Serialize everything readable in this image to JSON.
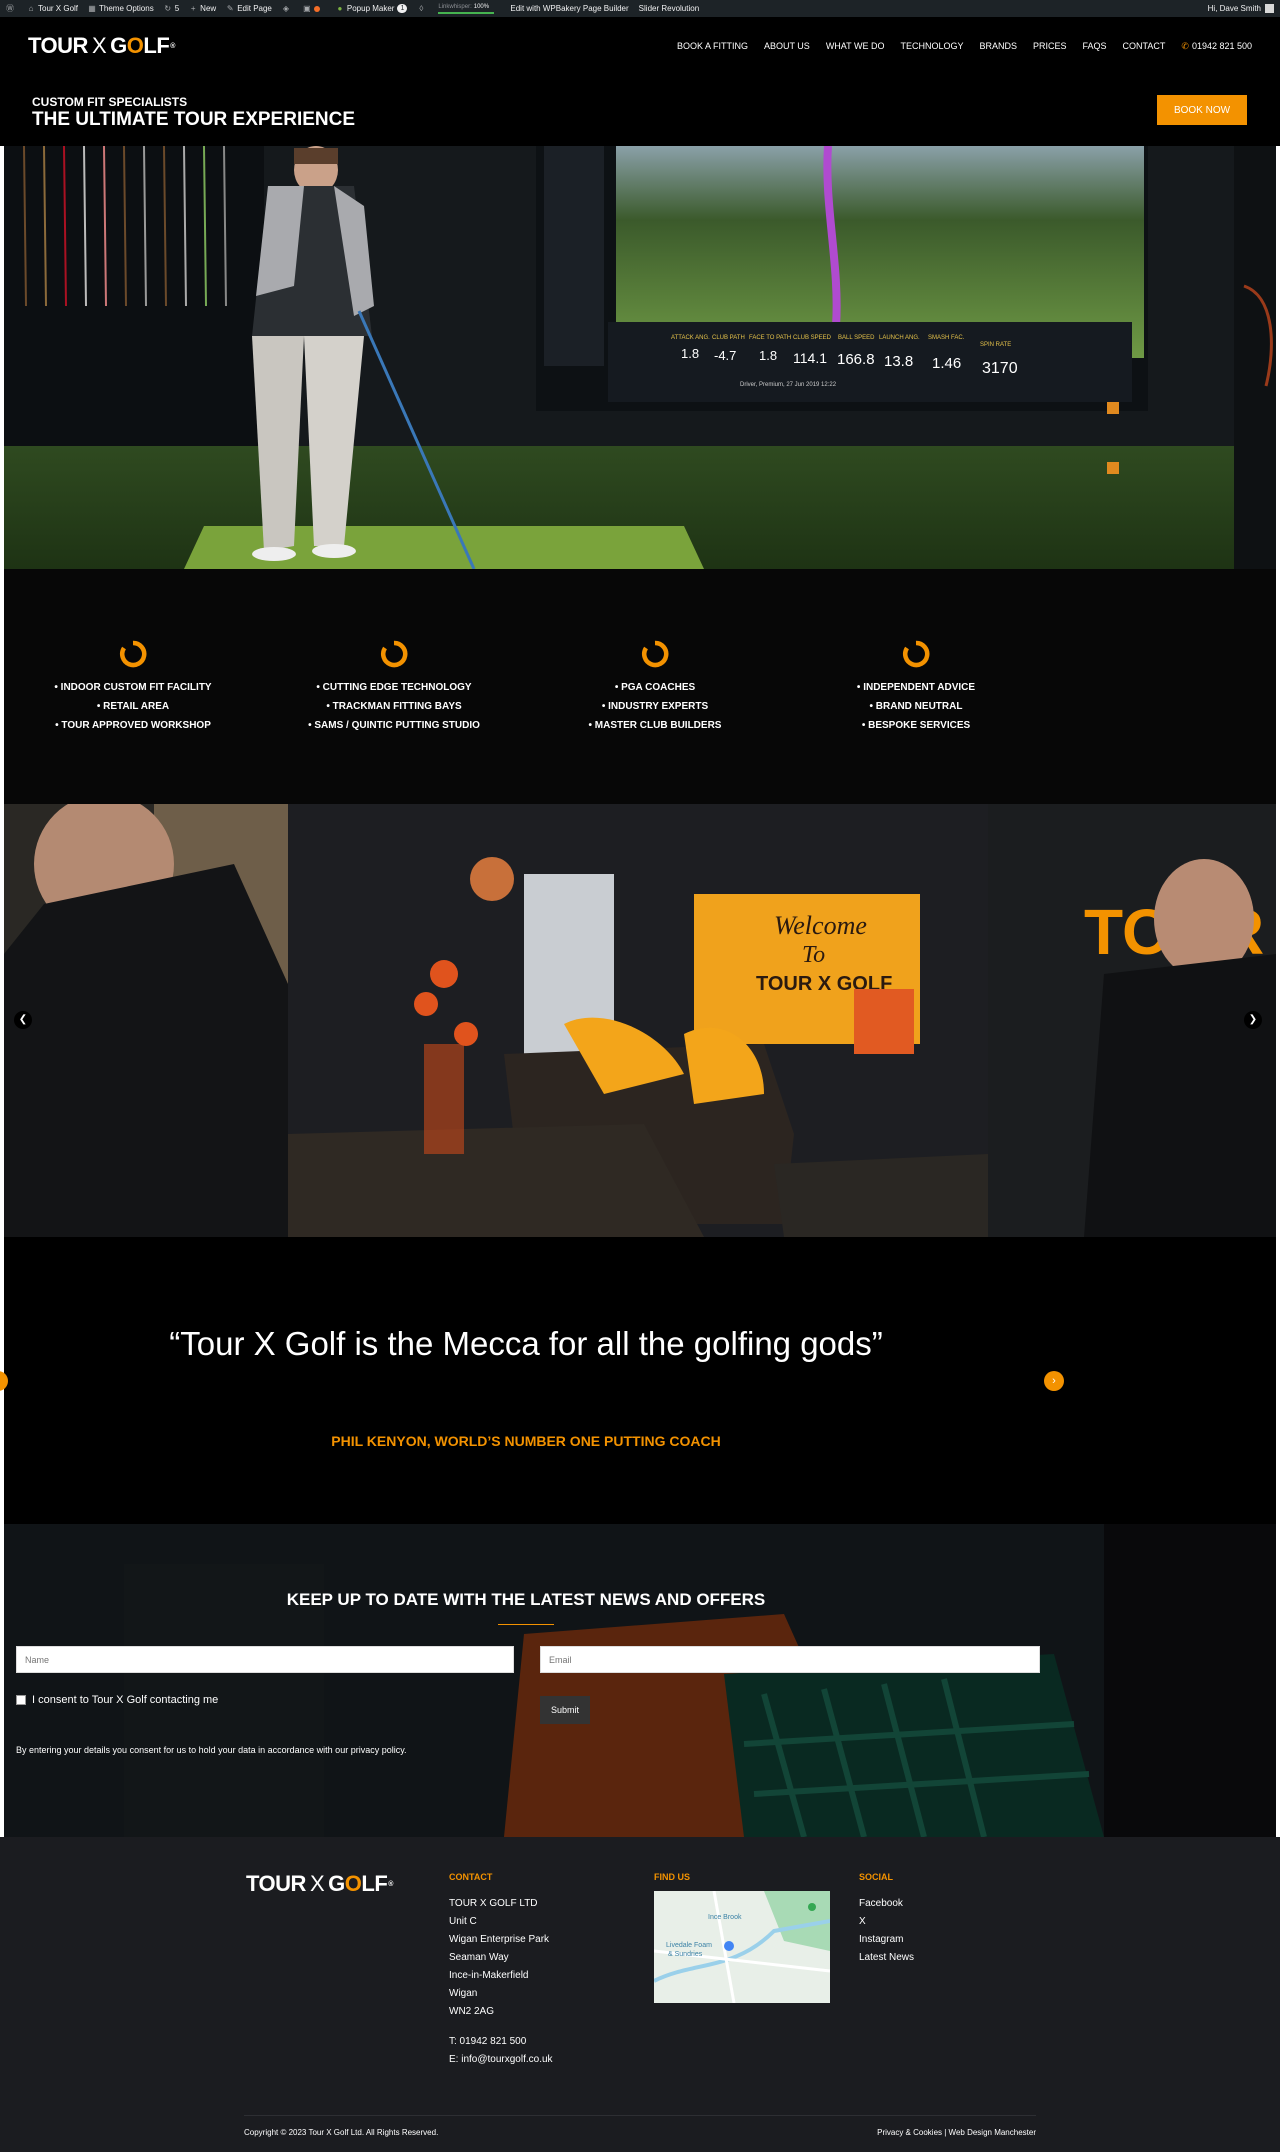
{
  "admin_bar": {
    "site_name": "Tour X Golf",
    "theme_options": "Theme Options",
    "updates_count": "5",
    "new_label": "New",
    "edit_page": "Edit Page",
    "popup_maker": "Popup Maker",
    "popup_count": "1",
    "linkwhisper_label": "Linkwhisper:",
    "linkwhisper_value": "100%",
    "wpbakery": "Edit with WPBakery Page Builder",
    "slider": "Slider Revolution",
    "greeting": "Hi, Dave Smith"
  },
  "nav": {
    "logo_left": "TOUR",
    "logo_x": "X",
    "logo_right_g": "G",
    "logo_right_o": "O",
    "logo_right_lf": "LF",
    "logo_tm": "®",
    "items": [
      "BOOK A FITTING",
      "ABOUT US",
      "WHAT WE DO",
      "TECHNOLOGY",
      "BRANDS",
      "PRICES",
      "FAQS",
      "CONTACT"
    ],
    "phone": "01942 821 500"
  },
  "hero": {
    "subtitle": "CUSTOM FIT SPECIALISTS",
    "title": "THE ULTIMATE TOUR EXPERIENCE",
    "book_button": "BOOK NOW"
  },
  "banner": {
    "stats_headers": [
      "ATTACK ANG.",
      "CLUB PATH",
      "FACE TO PATH",
      "CLUB SPEED",
      "BALL SPEED",
      "LAUNCH ANG.",
      "SMASH FAC.",
      "SPIN RATE"
    ],
    "stats_values": [
      "1.8",
      "-4.7",
      "1.8",
      "114.1",
      "166.8",
      "13.8",
      "1.46",
      "3170"
    ],
    "screen_footer": "Driver, Premium, 27 Jun 2019 12:22"
  },
  "features": [
    {
      "lines": [
        "• INDOOR CUSTOM FIT FACILITY",
        "• RETAIL AREA",
        "• TOUR APPROVED WORKSHOP"
      ]
    },
    {
      "lines": [
        "• CUTTING EDGE TECHNOLOGY",
        "• TRACKMAN FITTING BAYS",
        "• SAMS / QUINTIC PUTTING STUDIO"
      ]
    },
    {
      "lines": [
        "• PGA COACHES",
        "• INDUSTRY EXPERTS",
        "• MASTER CLUB BUILDERS"
      ]
    },
    {
      "lines": [
        "• INDEPENDENT ADVICE",
        "• BRAND NEUTRAL",
        "• BESPOKE SERVICES"
      ]
    }
  ],
  "gallery": {
    "prev_icon": "chevron-left-icon",
    "next_icon": "chevron-right-icon",
    "welcome_line1": "Welcome",
    "welcome_line2": "To",
    "welcome_brand": "TOUR X GOLF",
    "wall_text": "TOUR G"
  },
  "testimonial": {
    "quote": "“Tour X Golf is the Mecca for all the golfing gods”",
    "author": "PHIL KENYON, WORLD’S NUMBER ONE PUTTING COACH"
  },
  "newsletter": {
    "title": "KEEP UP TO DATE WITH THE LATEST NEWS AND OFFERS",
    "name_placeholder": "Name",
    "email_placeholder": "Email",
    "consent": "I consent to Tour X Golf contacting me",
    "submit": "Submit",
    "privacy": "By entering your details you consent for us to hold your data in accordance with our privacy policy."
  },
  "footer": {
    "contact_heading": "CONTACT",
    "address": [
      "TOUR X GOLF LTD",
      "Unit C",
      "Wigan Enterprise Park",
      "Seaman Way",
      "Ince-in-Makerfield",
      "Wigan",
      "WN2 2AG"
    ],
    "phone": "T: 01942 821 500",
    "email": "E: info@tourxgolf.co.uk",
    "find_heading": "FIND US",
    "map_label_1": "Ince Brook",
    "map_label_2": "Livedale Foam",
    "map_label_3": "& Sundries",
    "social_heading": "SOCIAL",
    "social": [
      "Facebook",
      "X",
      "Instagram",
      "Latest News"
    ],
    "copyright": "Copyright © 2023 Tour X Golf Ltd. All Rights Reserved.",
    "bottom_links": "Privacy & Cookies | Web Design Manchester"
  },
  "colors": {
    "accent": "#f39200",
    "background": "#000000",
    "footer": "#1b1c20",
    "admin_bar": "#1d2327"
  }
}
